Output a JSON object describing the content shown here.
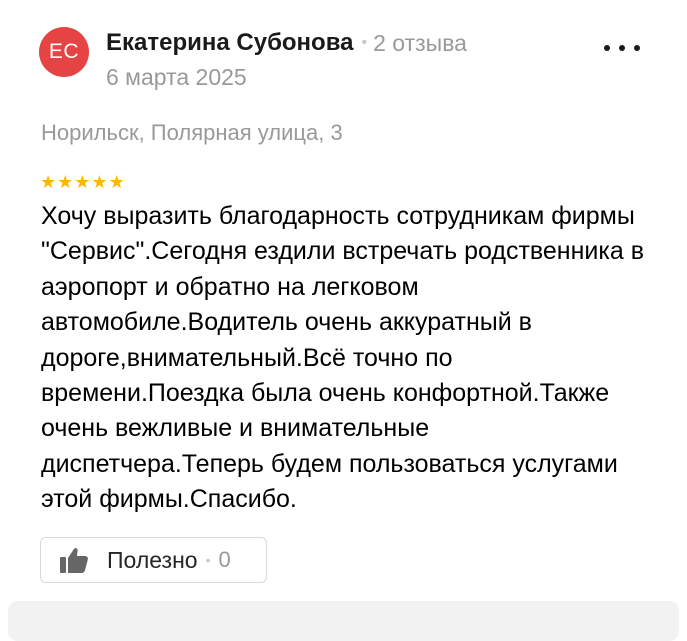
{
  "author": {
    "initials": "ЕС",
    "name": "Екатерина Субонова",
    "separator": "•",
    "reviews_count": "2 отзыва",
    "date": "6 марта 2025",
    "avatar_color": "#e64444"
  },
  "menu": {
    "icon": "more-dots-icon"
  },
  "address": "Норильск, Полярная улица, 3",
  "rating": {
    "value": 5,
    "max": 5,
    "star_color": "#fcb800"
  },
  "review": {
    "text": "Хочу выразить благодарность сотрудникам фирмы \"Сервис\".Сегодня ездили встречать родственника в аэропорт и обратно на легковом автомобиле.Водитель очень аккуратный в дороге,внимательный.Всё точно по времени.Поездка была очень конфортной.Также очень вежливые и внимательные диспетчера.Теперь будем пользоваться услугами этой фирмы.Спасибо."
  },
  "helpful": {
    "icon": "thumbs-up-icon",
    "label": "Полезно",
    "separator": "•",
    "count": "0"
  }
}
